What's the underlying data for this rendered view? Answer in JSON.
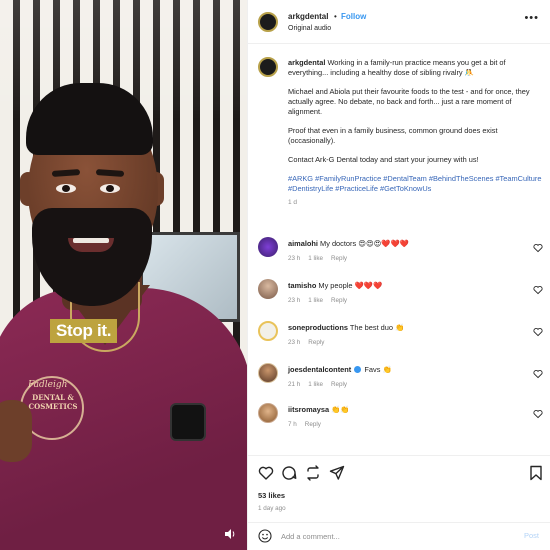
{
  "video": {
    "caption": "Stop it.",
    "logo_script": "Fadleigh",
    "logo_text": "DENTAL & COSMETICS",
    "volume_icon": "speaker-icon"
  },
  "header": {
    "username": "arkgdental",
    "separator": "•",
    "follow_label": "Follow",
    "audio": "Original audio",
    "more_icon": "more-icon"
  },
  "post": {
    "username": "arkgdental",
    "text1": "Working in a family-run practice means you get a bit of everything... including a healthy dose of sibling rivalry 🤼",
    "text2": "Michael and Abiola put their favourite foods to the test - and for once, they actually agree. No debate, no back and forth... just a rare moment of alignment.",
    "text3": "Proof that even in a family business, common ground does exist (occasionally).",
    "text4": "Contact Ark-G Dental today and start your journey with us!",
    "hashtags": "#ARKG #FamilyRunPractice #DentalTeam #BehindTheScenes #TeamCulture #DentistryLife #PracticeLife #GetToKnowUs",
    "time": "1 d"
  },
  "comments": [
    {
      "user": "aimalohi",
      "text": "My doctors 😍😍😍❤️❤️❤️",
      "time": "23 h",
      "likes": "1 like",
      "reply": "Reply"
    },
    {
      "user": "tamisho",
      "text": "My people ❤️❤️❤️",
      "time": "23 h",
      "likes": "1 like",
      "reply": "Reply"
    },
    {
      "user": "soneproductions",
      "text": "The best duo 👏",
      "time": "23 h",
      "likes": "",
      "reply": "Reply"
    },
    {
      "user": "joesdentalcontent",
      "text": "Favs 👏",
      "time": "21 h",
      "likes": "1 like",
      "reply": "Reply"
    },
    {
      "user": "iitsromaysa",
      "text": "👏👏",
      "time": "7 h",
      "likes": "",
      "reply": "Reply"
    }
  ],
  "actions": {
    "like_icon": "heart-icon",
    "comment_icon": "comment-icon",
    "share_icon": "repost-icon",
    "send_icon": "send-icon",
    "save_icon": "bookmark-icon",
    "likes": "53 likes",
    "ago": "1 day ago"
  },
  "add_comment": {
    "placeholder": "Add a comment...",
    "post_label": "Post",
    "emoji_icon": "emoji-icon"
  },
  "colors": {
    "accent": "#3897f0",
    "hashtag": "#3867b8",
    "scrubs": "#8c2a55",
    "caption_bg": "#bda33f"
  }
}
